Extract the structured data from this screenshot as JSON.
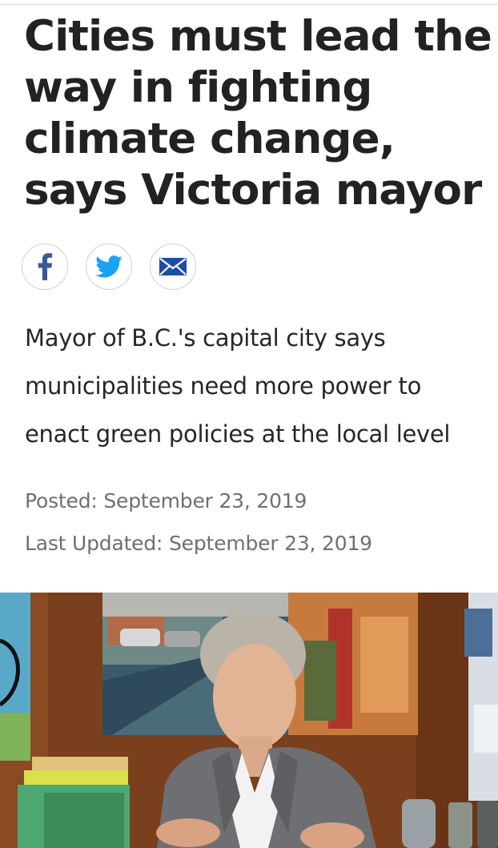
{
  "article": {
    "headline": "Cities must lead the way in fighting climate change, says Victoria mayor",
    "subheadline": "Mayor of B.C.'s capital city says municipalities need more power to enact green policies at the local level",
    "posted_label": "Posted:",
    "posted_date": "September 23, 2019",
    "updated_label": "Last Updated:",
    "updated_date": "September 23, 2019"
  },
  "share": {
    "buttons": [
      {
        "icon": "facebook-icon",
        "color": "#3b5998"
      },
      {
        "icon": "twitter-icon",
        "color": "#1da1f2"
      },
      {
        "icon": "email-icon",
        "color": "#1a4fa3"
      }
    ]
  },
  "photo": {
    "icon": "photo-image"
  }
}
